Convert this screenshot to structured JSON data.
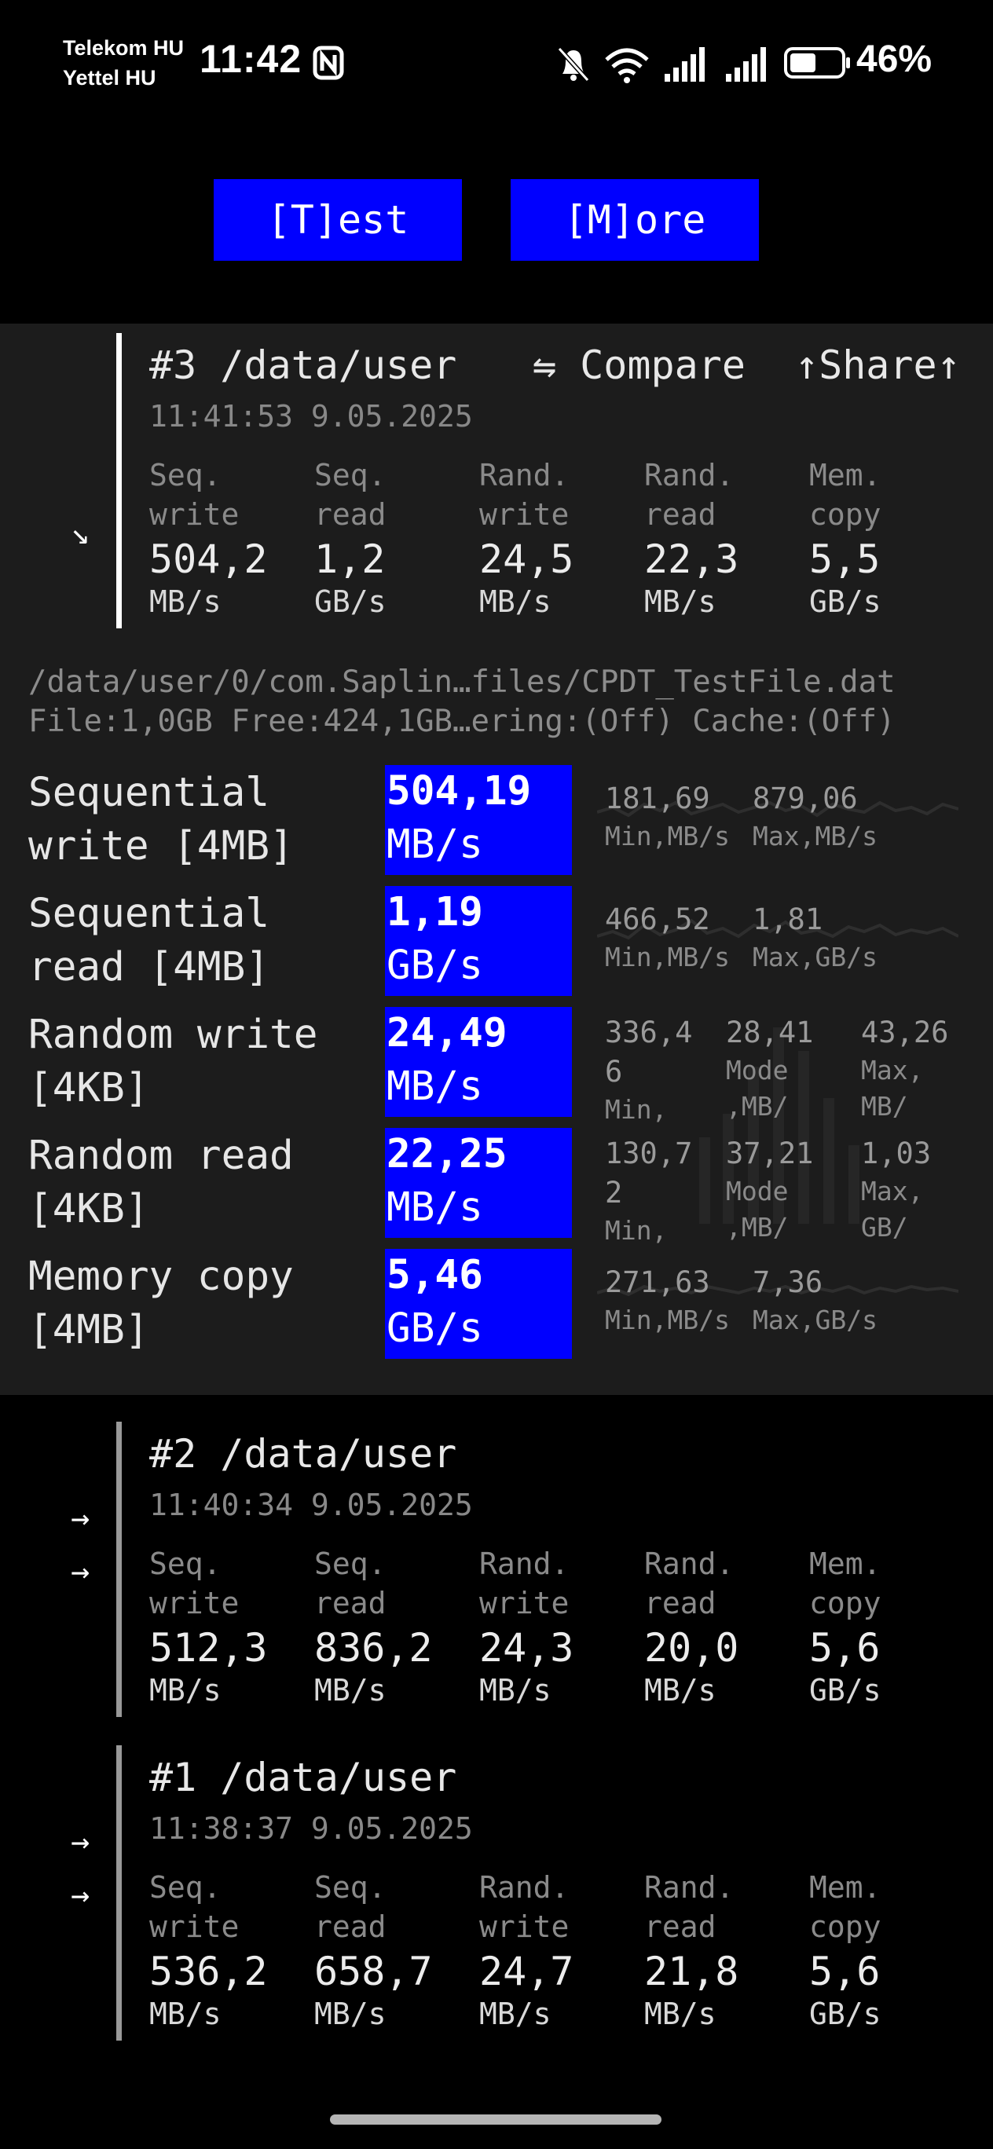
{
  "status_bar": {
    "carrier1": "Telekom HU",
    "carrier2": "Yettel HU",
    "time": "11:42",
    "battery": "46%"
  },
  "buttons": {
    "test": "[T]est",
    "more": "[M]ore"
  },
  "results": [
    {
      "title": "#3 /data/user",
      "timestamp": "11:41:53 9.05.2025",
      "compare": "⇋ Compare",
      "share": "↑Share↑",
      "arrow": "↘",
      "metrics": [
        {
          "label": "Seq.\nwrite",
          "value": "504,2",
          "unit": "MB/s"
        },
        {
          "label": "Seq.\nread",
          "value": "1,2",
          "unit": "GB/s"
        },
        {
          "label": "Rand.\nwrite",
          "value": "24,5",
          "unit": "MB/s"
        },
        {
          "label": "Rand.\nread",
          "value": "22,3",
          "unit": "MB/s"
        },
        {
          "label": "Mem.\ncopy",
          "value": "5,5",
          "unit": "GB/s"
        }
      ]
    },
    {
      "title": "#2 /data/user",
      "timestamp": "11:40:34 9.05.2025",
      "arrow1": "→",
      "arrow2": "→",
      "metrics": [
        {
          "label": "Seq.\nwrite",
          "value": "512,3",
          "unit": "MB/s"
        },
        {
          "label": "Seq.\nread",
          "value": "836,2",
          "unit": "MB/s"
        },
        {
          "label": "Rand.\nwrite",
          "value": "24,3",
          "unit": "MB/s"
        },
        {
          "label": "Rand.\nread",
          "value": "20,0",
          "unit": "MB/s"
        },
        {
          "label": "Mem.\ncopy",
          "value": "5,6",
          "unit": "GB/s"
        }
      ]
    },
    {
      "title": "#1 /data/user",
      "timestamp": "11:38:37 9.05.2025",
      "arrow1": "→",
      "arrow2": "→",
      "metrics": [
        {
          "label": "Seq.\nwrite",
          "value": "536,2",
          "unit": "MB/s"
        },
        {
          "label": "Seq.\nread",
          "value": "658,7",
          "unit": "MB/s"
        },
        {
          "label": "Rand.\nwrite",
          "value": "24,7",
          "unit": "MB/s"
        },
        {
          "label": "Rand.\nread",
          "value": "21,8",
          "unit": "MB/s"
        },
        {
          "label": "Mem.\ncopy",
          "value": "5,6",
          "unit": "GB/s"
        }
      ]
    }
  ],
  "details": {
    "path": "/data/user/0/com.Saplin…files/CPDT_TestFile.dat",
    "file_info": "File:1,0GB Free:424,1GB…ering:(Off) Cache:(Off)",
    "tests": [
      {
        "name": "Sequential\nwrite [4MB]",
        "value": "504,19",
        "unit": "MB/s",
        "stats": [
          {
            "v": "181,69",
            "s": "Min,MB/s"
          },
          {
            "v": "879,06",
            "s": "Max,MB/s"
          }
        ]
      },
      {
        "name": "Sequential\nread [4MB]",
        "value": "1,19",
        "unit": "GB/s",
        "stats": [
          {
            "v": "466,52",
            "s": "Min,MB/s"
          },
          {
            "v": "1,81",
            "s": "Max,GB/s"
          }
        ]
      },
      {
        "name": "Random write\n[4KB]",
        "value": "24,49",
        "unit": "MB/s",
        "stats": [
          {
            "v": "336,4\n6",
            "s": "Min,"
          },
          {
            "v": "28,41",
            "s": "Mode\n,MB/"
          },
          {
            "v": "43,26",
            "s": "Max,\nMB/"
          }
        ]
      },
      {
        "name": "Random read\n[4KB]",
        "value": "22,25",
        "unit": "MB/s",
        "stats": [
          {
            "v": "130,7\n2",
            "s": "Min,"
          },
          {
            "v": "37,21",
            "s": "Mode\n,MB/"
          },
          {
            "v": "1,03",
            "s": "Max,\nGB/"
          }
        ]
      },
      {
        "name": "Memory copy\n[4MB]",
        "value": "5,46",
        "unit": "GB/s",
        "stats": [
          {
            "v": "271,63",
            "s": "Min,MB/s"
          },
          {
            "v": "7,36",
            "s": "Max,GB/s"
          }
        ]
      }
    ]
  }
}
